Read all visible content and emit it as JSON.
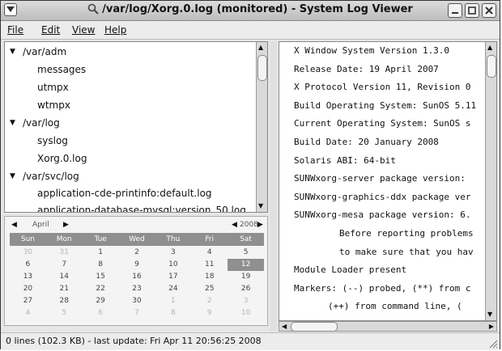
{
  "window": {
    "title": "/var/log/Xorg.0.log (monitored) - System Log Viewer"
  },
  "menu": [
    {
      "label": "File"
    },
    {
      "label": "Edit"
    },
    {
      "label": "View"
    },
    {
      "label": "Help"
    }
  ],
  "tree": [
    {
      "label": "/var/adm",
      "level": 0,
      "expanded": true
    },
    {
      "label": "messages",
      "level": 1
    },
    {
      "label": "utmpx",
      "level": 1
    },
    {
      "label": "wtmpx",
      "level": 1
    },
    {
      "label": "/var/log",
      "level": 0,
      "expanded": true
    },
    {
      "label": "syslog",
      "level": 1
    },
    {
      "label": "Xorg.0.log",
      "level": 1
    },
    {
      "label": "/var/svc/log",
      "level": 0,
      "expanded": true
    },
    {
      "label": "application-cde-printinfo:default.log",
      "level": 1
    },
    {
      "label": "application-database-mysql:version_50.log",
      "level": 1
    }
  ],
  "calendar": {
    "month": "April",
    "year": "2008",
    "day_names": [
      "Sun",
      "Mon",
      "Tue",
      "Wed",
      "Thu",
      "Fri",
      "Sat"
    ],
    "weeks": [
      [
        "30",
        "31",
        "1",
        "2",
        "3",
        "4",
        "5"
      ],
      [
        "6",
        "7",
        "8",
        "9",
        "10",
        "11",
        "12"
      ],
      [
        "13",
        "14",
        "15",
        "16",
        "17",
        "18",
        "19"
      ],
      [
        "20",
        "21",
        "22",
        "23",
        "24",
        "25",
        "26"
      ],
      [
        "27",
        "28",
        "29",
        "30",
        "1",
        "2",
        "3"
      ],
      [
        "4",
        "5",
        "6",
        "7",
        "8",
        "9",
        "10"
      ]
    ],
    "selected_day": "12"
  },
  "log_lines": [
    {
      "text": "X Window System Version 1.3.0",
      "indent": 0
    },
    {
      "text": "Release Date: 19 April 2007",
      "indent": 0
    },
    {
      "text": "X Protocol Version 11, Revision 0",
      "indent": 0
    },
    {
      "text": "Build Operating System: SunOS 5.11",
      "indent": 0
    },
    {
      "text": "Current Operating System: SunOS s",
      "indent": 0
    },
    {
      "text": "Build Date: 20 January 2008",
      "indent": 0
    },
    {
      "text": "Solaris ABI: 64-bit",
      "indent": 0
    },
    {
      "text": "SUNWxorg-server package version:",
      "indent": 0
    },
    {
      "text": "SUNWxorg-graphics-ddx package ver",
      "indent": 0
    },
    {
      "text": "SUNWxorg-mesa package version: 6.",
      "indent": 0
    },
    {
      "text": "Before reporting problems",
      "indent": 1
    },
    {
      "text": "to make sure that you hav",
      "indent": 1
    },
    {
      "text": "Module Loader present",
      "indent": 0
    },
    {
      "text": "Markers: (--) probed, (**) from c",
      "indent": 0
    },
    {
      "text": "(++) from command line, (",
      "indent": 2
    }
  ],
  "status": {
    "text": "0 lines (102.3 KB) - last update: Fri Apr 11 20:56:25 2008"
  },
  "icons": {
    "title": "magnifier-icon",
    "window_menu": "window-menu-icon",
    "minimize": "minimize-icon",
    "maximize": "maximize-icon",
    "close": "close-icon"
  }
}
